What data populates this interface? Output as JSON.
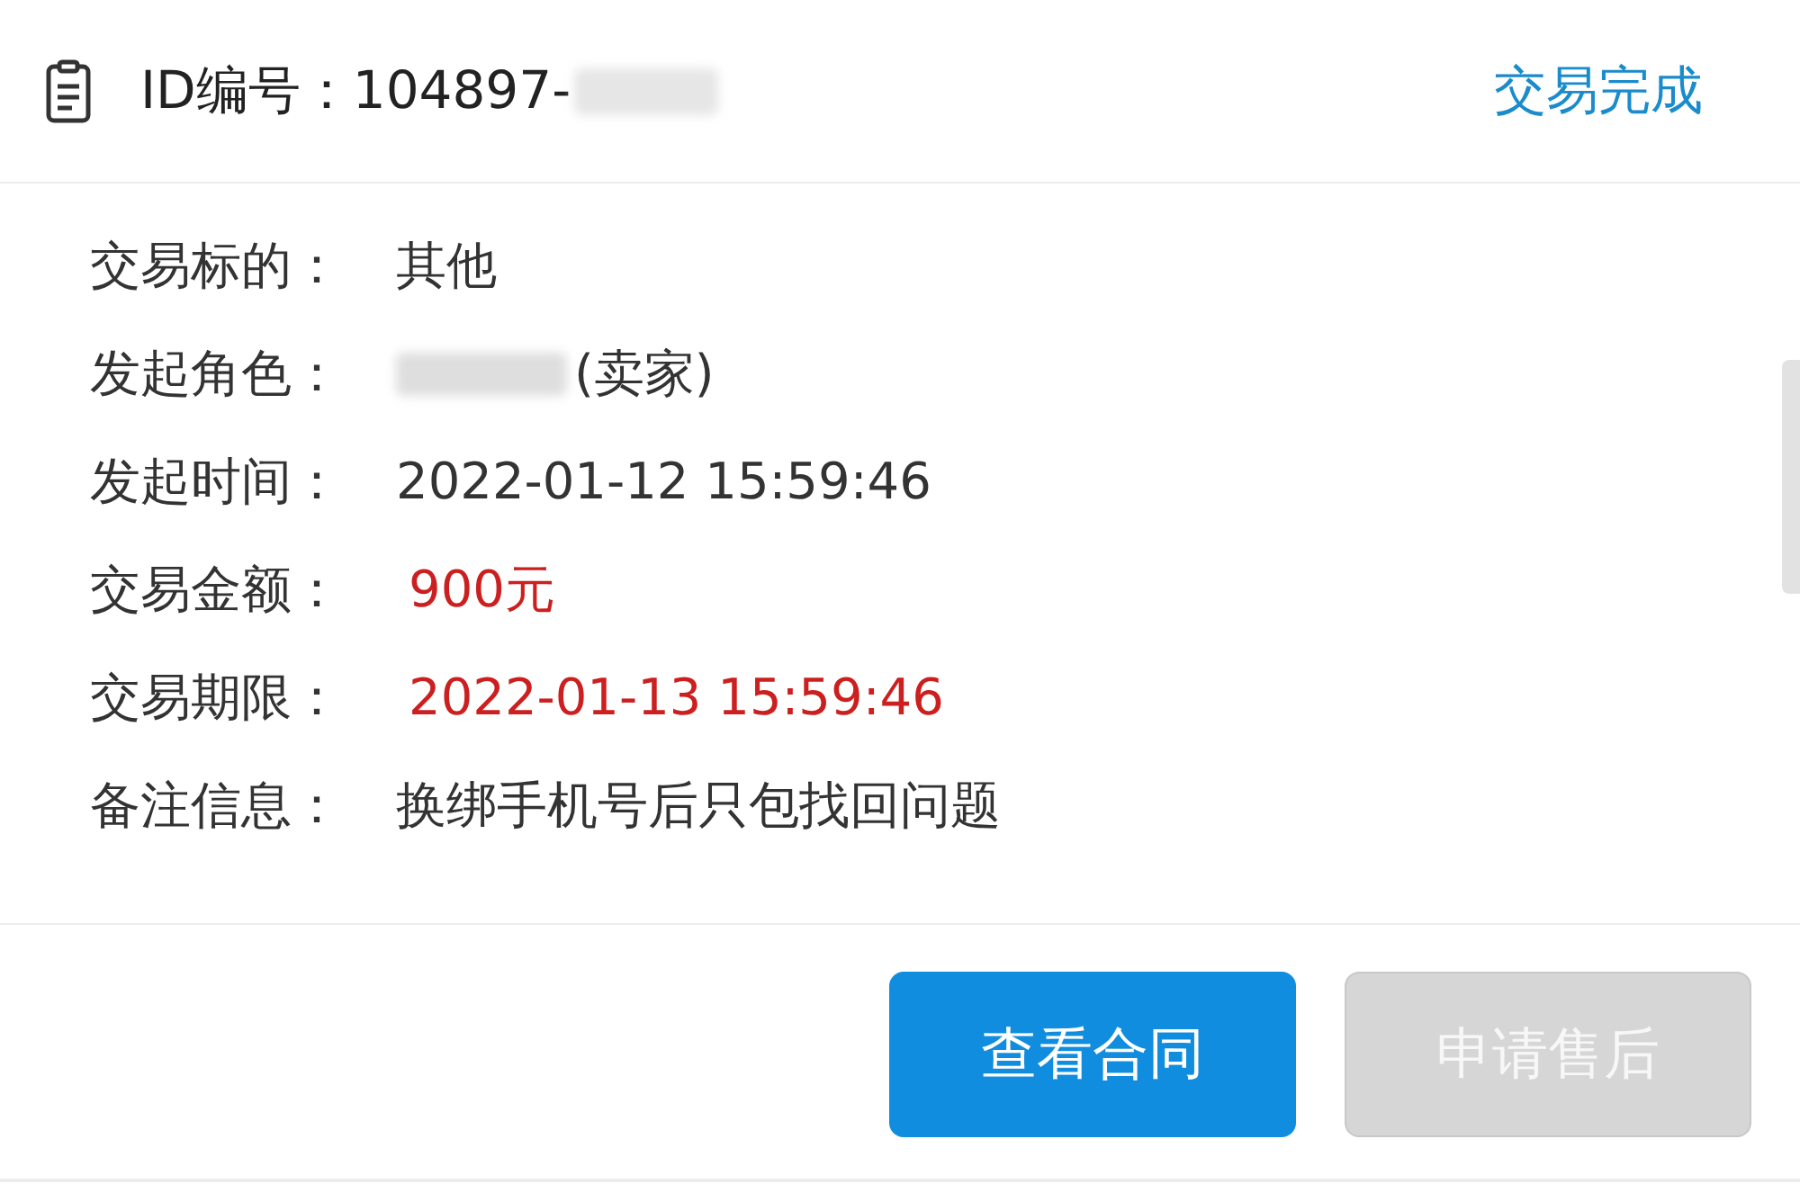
{
  "header": {
    "id_label": "ID编号：",
    "id_value": "104897-",
    "id_redacted": true,
    "status": "交易完成"
  },
  "fields": [
    {
      "label": "交易标的：",
      "value": "其他",
      "kind": "normal",
      "redacted": false
    },
    {
      "label": "发起角色：",
      "value": "(卖家)",
      "kind": "normal",
      "redacted": true
    },
    {
      "label": "发起时间：",
      "value": "2022-01-12 15:59:46",
      "kind": "normal",
      "redacted": false
    },
    {
      "label": "交易金额：",
      "value": "900元",
      "kind": "highlight",
      "redacted": false
    },
    {
      "label": "交易期限：",
      "value": "2022-01-13 15:59:46",
      "kind": "highlight",
      "redacted": false
    },
    {
      "label": "备注信息：",
      "value": "换绑手机号后只包找回问题",
      "kind": "normal",
      "redacted": false
    }
  ],
  "buttons": [
    {
      "label": "查看合同",
      "disabled": false
    },
    {
      "label": "申请售后",
      "disabled": true
    }
  ]
}
